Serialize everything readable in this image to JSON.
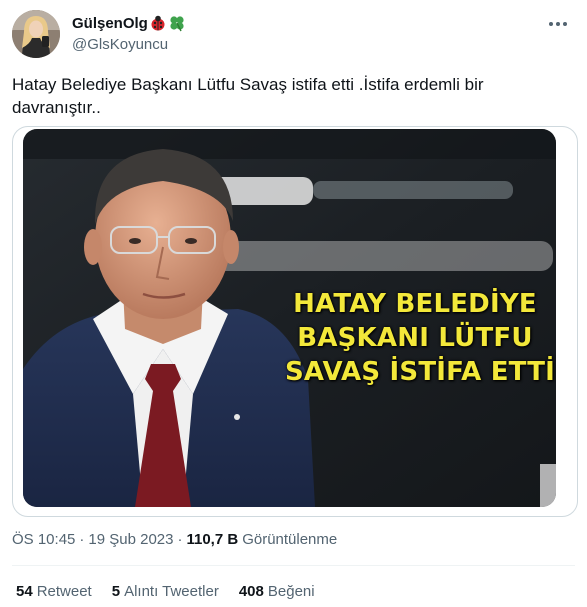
{
  "author": {
    "display_name": "GülşenOlg",
    "handle": "@GlsKoyuncu",
    "name_emojis": [
      "ladybug-icon",
      "four-leaf-clover-icon"
    ]
  },
  "tweet": {
    "text": "Hatay Belediye Başkanı Lütfu Savaş istifa etti .İstifa erdemli bir davranıştır.."
  },
  "media": {
    "headline_lines": [
      "HATAY BELEDİYE",
      "BAŞKANI LÜTFU",
      "SAVAŞ İSTİFA ETTİ"
    ]
  },
  "meta": {
    "time": "ÖS 10:45",
    "separator1": "·",
    "date": "19 Şub 2023",
    "separator2": "·",
    "views_count": "110,7 B",
    "views_label": "Görüntülenme"
  },
  "stats": {
    "retweets_count": "54",
    "retweets_label": "Retweet",
    "quotes_count": "5",
    "quotes_label": "Alıntı Tweetler",
    "likes_count": "408",
    "likes_label": "Beğeni"
  },
  "colors": {
    "headline": "#f3e83a",
    "secondary_text": "#536471",
    "primary_text": "#0f1419",
    "divider": "#eff3f4"
  }
}
